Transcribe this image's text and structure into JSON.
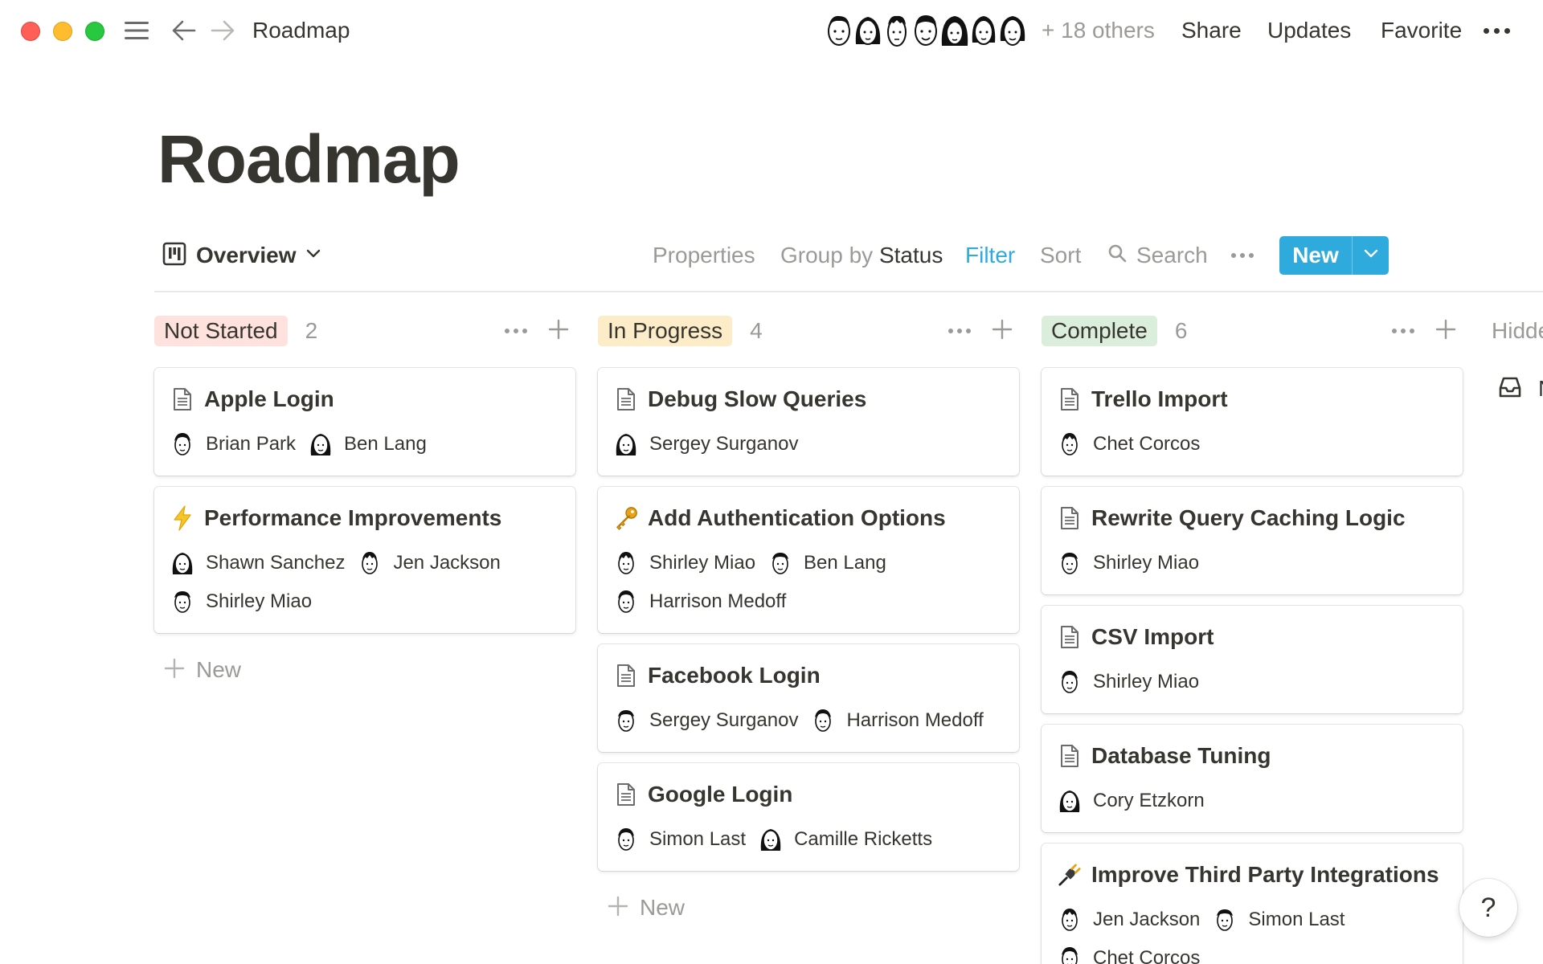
{
  "window": {
    "breadcrumb": "Roadmap"
  },
  "topbar": {
    "others": "+ 18 others",
    "share": "Share",
    "updates": "Updates",
    "favorite": "Favorite",
    "avatar_icons": [
      "face-avatar-icon",
      "face-avatar-icon",
      "face-avatar-icon",
      "face-avatar-icon",
      "face-avatar-icon",
      "face-avatar-icon",
      "face-avatar-icon"
    ]
  },
  "page": {
    "title": "Roadmap"
  },
  "toolbar": {
    "view": "Overview",
    "properties": "Properties",
    "group_by_prefix": "Group by",
    "group_by_value": "Status",
    "filter": "Filter",
    "sort": "Sort",
    "search": "Search",
    "new": "New"
  },
  "board": {
    "columns": [
      {
        "status": "Not Started",
        "count": "2",
        "pill_color": "#ffe2dd",
        "cards": [
          {
            "icon": "page-icon",
            "title": "Apple Login",
            "people": [
              "Brian Park",
              "Ben Lang"
            ]
          },
          {
            "icon": "lightning-icon",
            "title": "Performance Improvements",
            "people": [
              "Shawn Sanchez",
              "Jen Jackson",
              "Shirley Miao"
            ]
          }
        ],
        "new_label": "New"
      },
      {
        "status": "In Progress",
        "count": "4",
        "pill_color": "#fdecc8",
        "cards": [
          {
            "icon": "page-icon",
            "title": "Debug Slow Queries",
            "people": [
              "Sergey Surganov"
            ]
          },
          {
            "icon": "key-icon",
            "title": "Add Authentication Options",
            "people": [
              "Shirley Miao",
              "Ben Lang",
              "Harrison Medoff"
            ]
          },
          {
            "icon": "page-icon",
            "title": "Facebook Login",
            "people": [
              "Sergey Surganov",
              "Harrison Medoff"
            ]
          },
          {
            "icon": "page-icon",
            "title": "Google Login",
            "people": [
              "Simon Last",
              "Camille Ricketts"
            ]
          }
        ],
        "new_label": "New"
      },
      {
        "status": "Complete",
        "count": "6",
        "pill_color": "#dbeddb",
        "cards": [
          {
            "icon": "page-icon",
            "title": "Trello Import",
            "people": [
              "Chet Corcos"
            ]
          },
          {
            "icon": "page-icon",
            "title": "Rewrite Query Caching Logic",
            "people": [
              "Shirley Miao"
            ]
          },
          {
            "icon": "page-icon",
            "title": "CSV Import",
            "people": [
              "Shirley Miao"
            ]
          },
          {
            "icon": "page-icon",
            "title": "Database Tuning",
            "people": [
              "Cory Etzkorn"
            ]
          },
          {
            "icon": "plug-icon",
            "title": "Improve Third Party Integrations",
            "people": [
              "Jen Jackson",
              "Simon Last",
              "Chet Corcos"
            ]
          }
        ]
      }
    ],
    "hidden": {
      "label": "Hidde",
      "item": "N"
    }
  },
  "help": {
    "label": "?"
  }
}
